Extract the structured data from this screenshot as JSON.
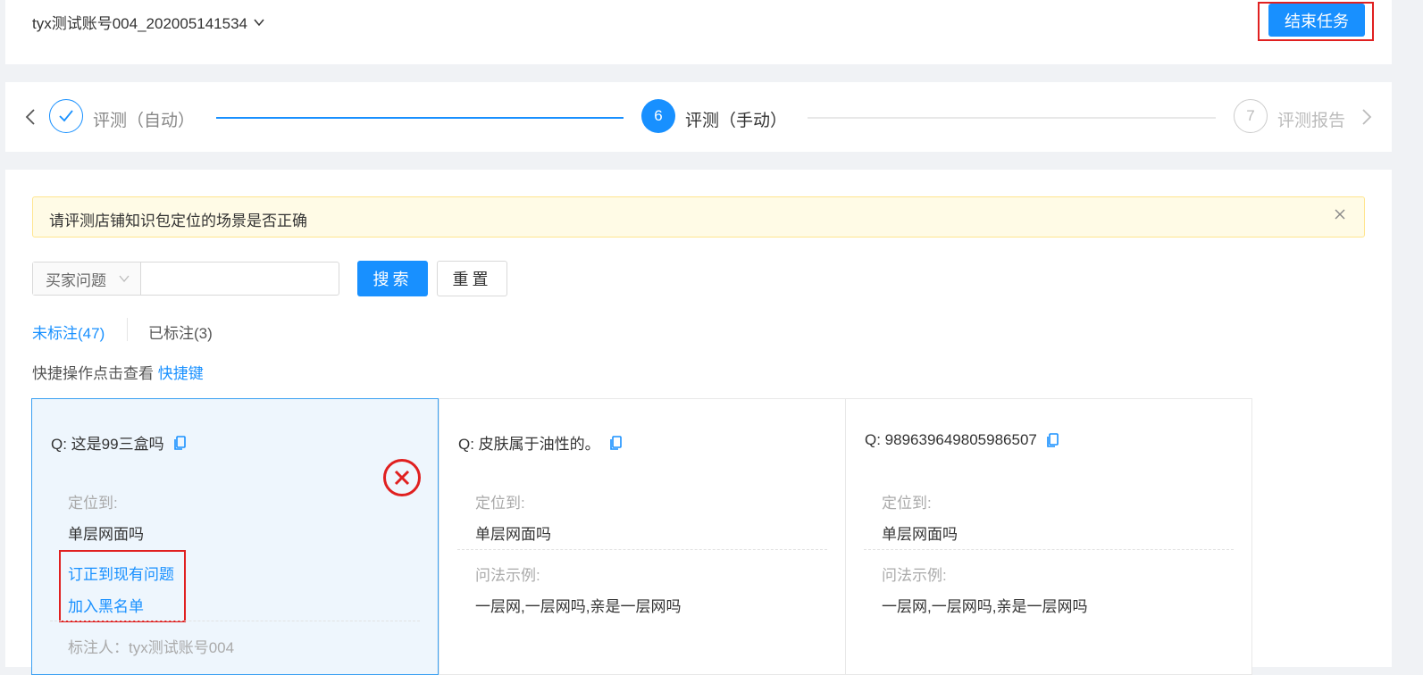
{
  "header": {
    "account_name": "tyx测试账号004_202005141534",
    "end_task_label": "结束任务"
  },
  "steps": {
    "prev": "‹",
    "next": "›",
    "items": [
      {
        "label": "评测（自动）",
        "status": "done",
        "number": ""
      },
      {
        "label": "评测（手动）",
        "status": "active",
        "number": "6"
      },
      {
        "label": "评测报告",
        "status": "wait",
        "number": "7"
      }
    ]
  },
  "alert": {
    "text": "请评测店铺知识包定位的场景是否正确",
    "close": "X"
  },
  "search": {
    "select_value": "买家问题",
    "input_value": "",
    "input_placeholder": "",
    "search_label": "搜索",
    "reset_label": "重置"
  },
  "tabs": {
    "unmarked": "未标注(47)",
    "marked": "已标注(3)"
  },
  "hint": {
    "text": "快捷操作点击查看",
    "link": "快捷键"
  },
  "cards": [
    {
      "question": "Q: 这是99三盒吗",
      "located_label": "定位到:",
      "located_value": "单层网面吗",
      "action_correct": "订正到现有问题",
      "action_blacklist": "加入黑名单",
      "annotator": "标注人：tyx测试账号004"
    },
    {
      "question": "Q: 皮肤属于油性的。",
      "located_label": "定位到:",
      "located_value": "单层网面吗",
      "examples_label": "问法示例:",
      "examples_value": "一层网,一层网吗,亲是一层网吗"
    },
    {
      "question": "Q: 989639649805986507",
      "located_label": "定位到:",
      "located_value": "单层网面吗",
      "examples_label": "问法示例:",
      "examples_value": "一层网,一层网吗,亲是一层网吗"
    }
  ],
  "colors": {
    "primary": "#1890ff",
    "highlight_red": "#e02020",
    "alert_bg": "#fffbe6"
  }
}
